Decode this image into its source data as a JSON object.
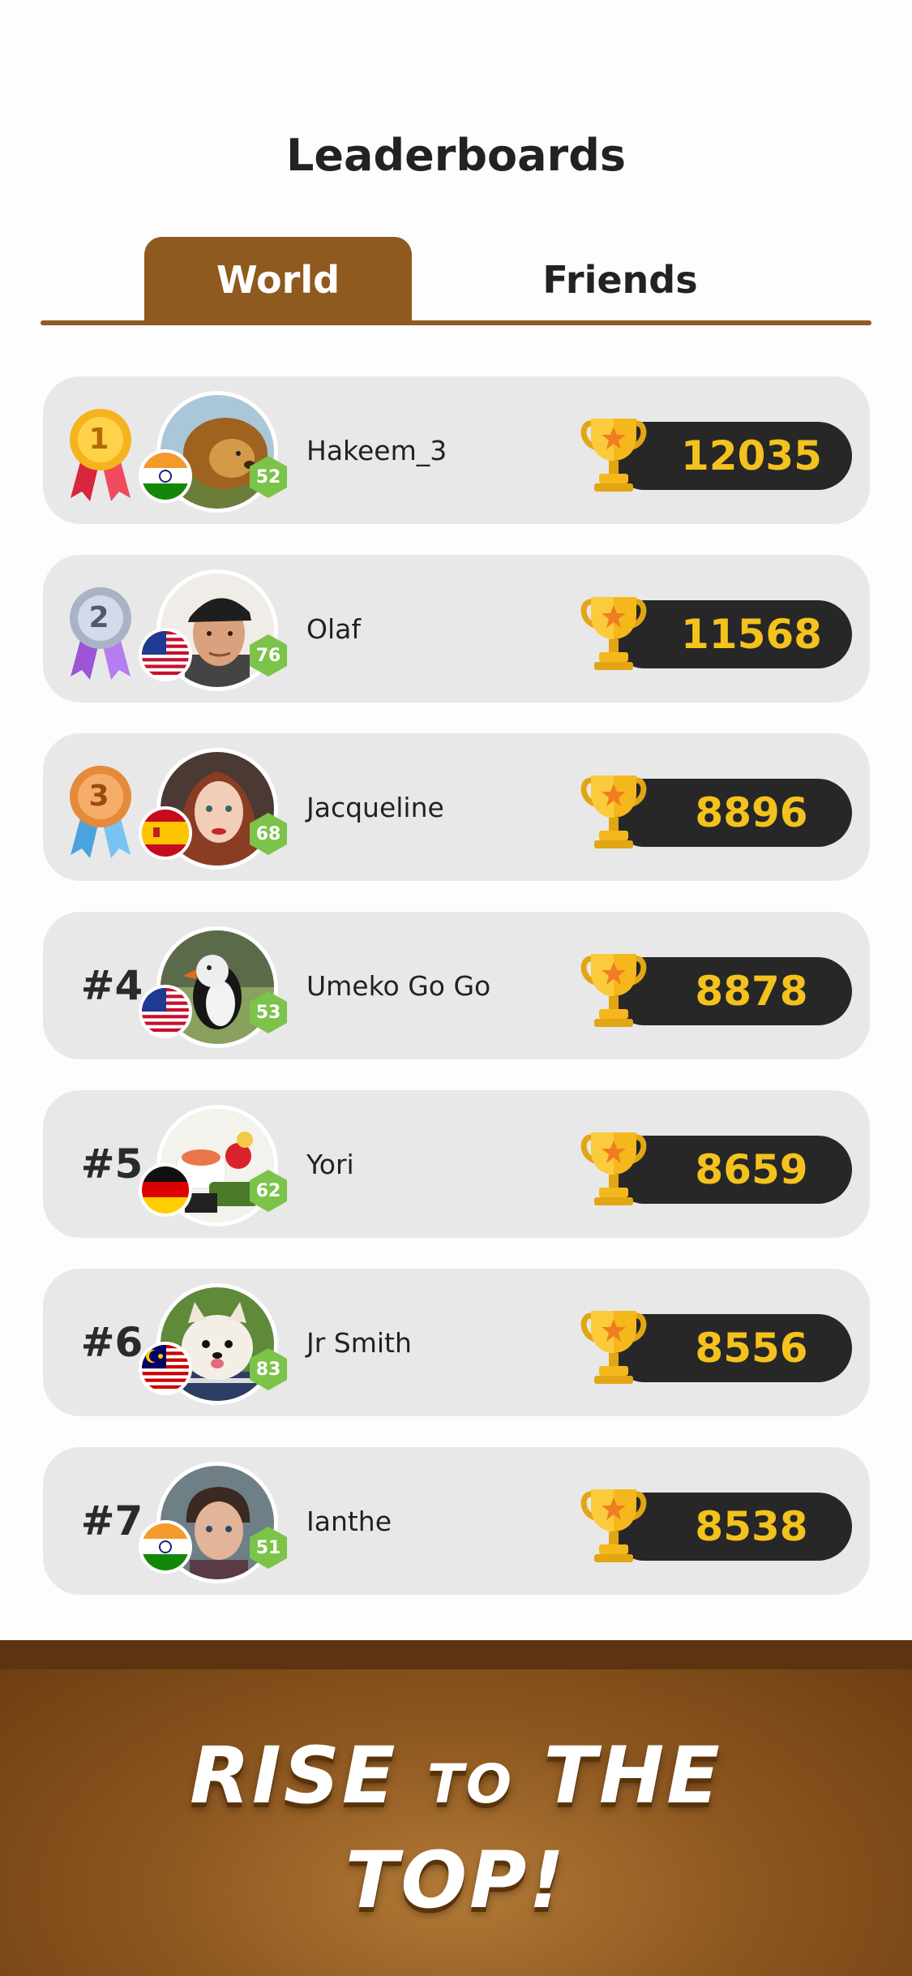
{
  "title": "Leaderboards",
  "tabs": {
    "world": "World",
    "friends": "Friends"
  },
  "players": [
    {
      "rank": "1",
      "name": "Hakeem_3",
      "level": "52",
      "score": "12035",
      "flag": "india",
      "avatar": "lion",
      "medal": "gold"
    },
    {
      "rank": "2",
      "name": "Olaf",
      "level": "76",
      "score": "11568",
      "flag": "usa",
      "avatar": "man-cap",
      "medal": "silver"
    },
    {
      "rank": "3",
      "name": "Jacqueline",
      "level": "68",
      "score": "8896",
      "flag": "spain",
      "avatar": "woman",
      "medal": "bronze"
    },
    {
      "rank": "#4",
      "name": "Umeko Go Go",
      "level": "53",
      "score": "8878",
      "flag": "usa",
      "avatar": "puffin",
      "medal": ""
    },
    {
      "rank": "#5",
      "name": "Yori",
      "level": "62",
      "score": "8659",
      "flag": "germany",
      "avatar": "sushi",
      "medal": ""
    },
    {
      "rank": "#6",
      "name": "Jr Smith",
      "level": "83",
      "score": "8556",
      "flag": "malaysia",
      "avatar": "dog",
      "medal": ""
    },
    {
      "rank": "#7",
      "name": "Ianthe",
      "level": "51",
      "score": "8538",
      "flag": "india",
      "avatar": "boy",
      "medal": ""
    }
  ],
  "banner": {
    "line1_a": "RISE ",
    "line1_small": "TO",
    "line1_b": " THE",
    "line2": "TOP!"
  },
  "colors": {
    "accent": "#8e5a1f",
    "score": "#f4c21d",
    "level_badge": "#7cc34a",
    "row_bg": "#e8e8e8"
  }
}
